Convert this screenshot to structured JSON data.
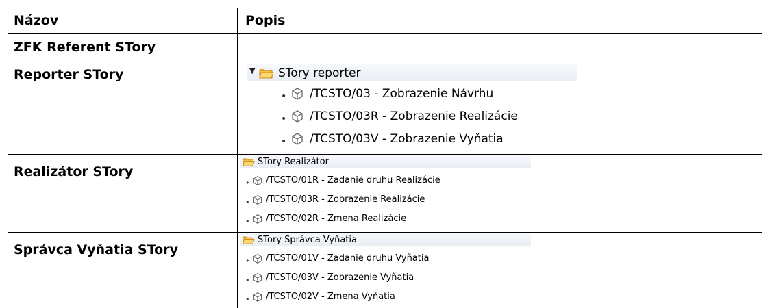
{
  "table": {
    "header": {
      "name": "Názov",
      "description": "Popis"
    },
    "rows": [
      {
        "name": "ZFK Referent STory"
      },
      {
        "name": "Reporter STory"
      },
      {
        "name": "Realizátor STory"
      },
      {
        "name": "Správca Vyňatia STory"
      }
    ]
  },
  "trees": [
    {
      "folder": "STory reporter",
      "expanded": true,
      "items": [
        "/TCSTO/03 - Zobrazenie Návrhu",
        "/TCSTO/03R - Zobrazenie Realizácie",
        "/TCSTO/03V - Zobrazenie Vyňatia"
      ]
    },
    {
      "folder": "STory Realizátor",
      "items": [
        "/TCSTO/01R - Zadanie druhu Realizácie",
        "/TCSTO/03R - Zobrazenie Realizácie",
        "/TCSTO/02R - Zmena Realizácie"
      ]
    },
    {
      "folder": "STory Správca Vyňatia",
      "items": [
        "/TCSTO/01V - Zadanie druhu Vyňatia",
        "/TCSTO/03V - Zobrazenie Vyňatia",
        "/TCSTO/02V - Zmena Vyňatia"
      ]
    }
  ],
  "colors": {
    "folder_fill": "#f6c04a",
    "folder_tab": "#e8a21c",
    "folder_open": "#fbd776",
    "tree_header_bg": "#eef2f7"
  },
  "icons": {
    "folder": "folder-open-icon",
    "transaction": "transaction-cube-icon",
    "caret": "caret-down-icon",
    "bullet": "bullet-icon"
  }
}
